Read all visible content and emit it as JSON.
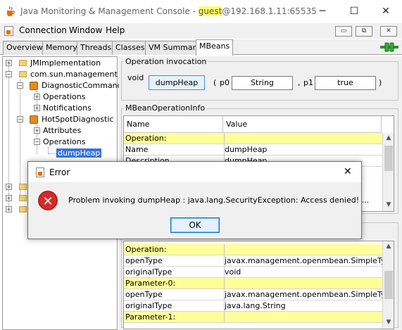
{
  "window": {
    "title_prefix": "Java Monitoring & Management Console - ",
    "title_user": "guest",
    "title_suffix": "@192.168.1.11:65535",
    "min_glyph": "─",
    "max_glyph": "☐",
    "close_glyph": "✕",
    "app_icon": "java-cup-icon"
  },
  "menubar": {
    "items": [
      "Connection",
      "Window",
      "Help"
    ],
    "inner_min": "▭",
    "inner_restore": "⧉",
    "inner_close": "✕"
  },
  "tabs": [
    "Overview",
    "Memory",
    "Threads",
    "Classes",
    "VM Summary",
    "MBeans"
  ],
  "active_tab": "MBeans",
  "tree": {
    "nodes": [
      "JMImplementation",
      "com.sun.management",
      "DiagnosticCommand",
      "Operations",
      "Notifications",
      "HotSpotDiagnostic",
      "Attributes",
      "Operations",
      "dumpHeap"
    ],
    "expand_plus": "+",
    "expand_minus": "−"
  },
  "operation_invocation": {
    "title": "Operation invocation",
    "return_type": "void",
    "button_label": "dumpHeap",
    "open_paren": "(",
    "p0_label": "p0",
    "p0_value": "String",
    "comma": ",",
    "p1_label": "p1",
    "p1_value": "true",
    "close_paren": ")"
  },
  "mbean_info": {
    "title": "MBeanOperationInfo",
    "columns": [
      "Name",
      "Value"
    ],
    "rows": [
      {
        "name": "Operation:",
        "value": "",
        "highlight": true
      },
      {
        "name": "Name",
        "value": "dumpHeap",
        "highlight": false
      },
      {
        "name": "Description",
        "value": "dumpHeap",
        "highlight": false
      }
    ]
  },
  "descriptor": {
    "rows": [
      {
        "name": "Operation:",
        "value": "",
        "highlight": true
      },
      {
        "name": "openType",
        "value": "javax.management.openmbean.SimpleType...",
        "highlight": false
      },
      {
        "name": "originalType",
        "value": "void",
        "highlight": false
      },
      {
        "name": "Parameter-0:",
        "value": "",
        "highlight": true
      },
      {
        "name": "openType",
        "value": "javax.management.openmbean.SimpleType...",
        "highlight": false
      },
      {
        "name": "originalType",
        "value": "java.lang.String",
        "highlight": false
      },
      {
        "name": "Parameter-1:",
        "value": "",
        "highlight": true
      }
    ]
  },
  "scroll": {
    "up": "▲",
    "down": "▼"
  },
  "dialog": {
    "title": "Error",
    "close_glyph": "✕",
    "icon": "error-icon",
    "icon_glyph": "✕",
    "message": "Problem invoking dumpHeap : java.lang.SecurityException: Access denied! ...",
    "ok_label": "OK"
  },
  "colors": {
    "highlight_row": "#ffff99",
    "selection": "#3875d7",
    "error_red": "#d42b2b"
  }
}
